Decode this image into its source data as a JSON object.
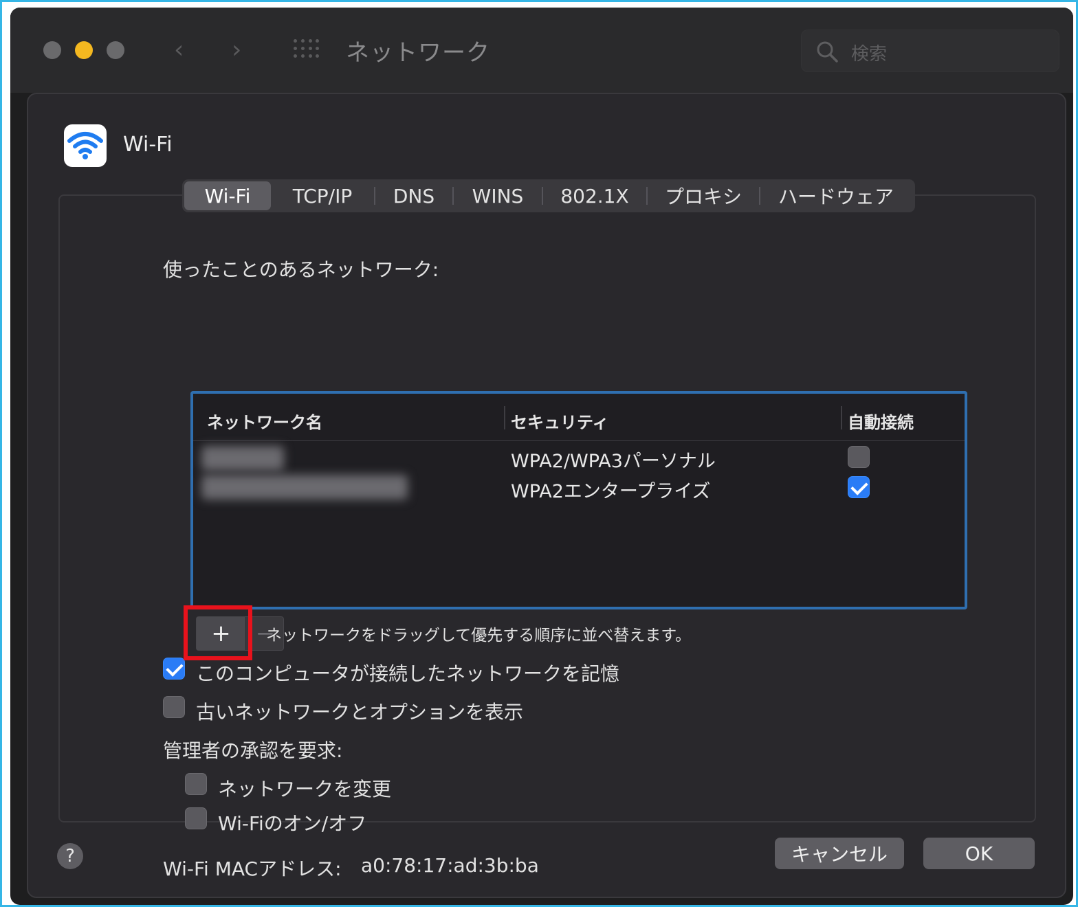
{
  "window": {
    "title": "ネットワーク",
    "search_placeholder": "検索",
    "traffic_colors": [
      "#6a6a6c",
      "#f4b820",
      "#6a6a6c"
    ]
  },
  "service": {
    "name": "Wi-Fi"
  },
  "tabs": [
    {
      "label": "Wi-Fi",
      "selected": true
    },
    {
      "label": "TCP/IP",
      "selected": false
    },
    {
      "label": "DNS",
      "selected": false
    },
    {
      "label": "WINS",
      "selected": false
    },
    {
      "label": "802.1X",
      "selected": false
    },
    {
      "label": "プロキシ",
      "selected": false
    },
    {
      "label": "ハードウェア",
      "selected": false
    }
  ],
  "known_networks": {
    "label": "使ったことのあるネットワーク:",
    "columns": [
      "ネットワーク名",
      "セキュリティ",
      "自動接続"
    ],
    "rows": [
      {
        "name": "",
        "security": "WPA2/WPA3パーソナル",
        "auto_join": false
      },
      {
        "name": "",
        "security": "WPA2エンタープライズ",
        "auto_join": true
      }
    ]
  },
  "list_controls": {
    "add_label": "+",
    "remove_label": "−",
    "hint": "ネットワークをドラッグして優先する順序に並べ替えます。"
  },
  "options": {
    "remember_networks": {
      "label": "このコンピュータが接続したネットワークを記憶",
      "checked": true
    },
    "show_legacy": {
      "label": "古いネットワークとオプションを表示",
      "checked": false
    }
  },
  "admin": {
    "label": "管理者の承認を要求:",
    "change_networks": {
      "label": "ネットワークを変更",
      "checked": false
    },
    "toggle_wifi": {
      "label": "Wi-Fiのオン/オフ",
      "checked": false
    }
  },
  "mac": {
    "label": "Wi-Fi MACアドレス:",
    "value": "a0:78:17:ad:3b:ba"
  },
  "footer": {
    "help_label": "?",
    "cancel_label": "キャンセル",
    "ok_label": "OK"
  },
  "colors": {
    "accent": "#2a7cf6",
    "highlight": "#e8121c",
    "focus_ring": "#2f6fb0"
  }
}
